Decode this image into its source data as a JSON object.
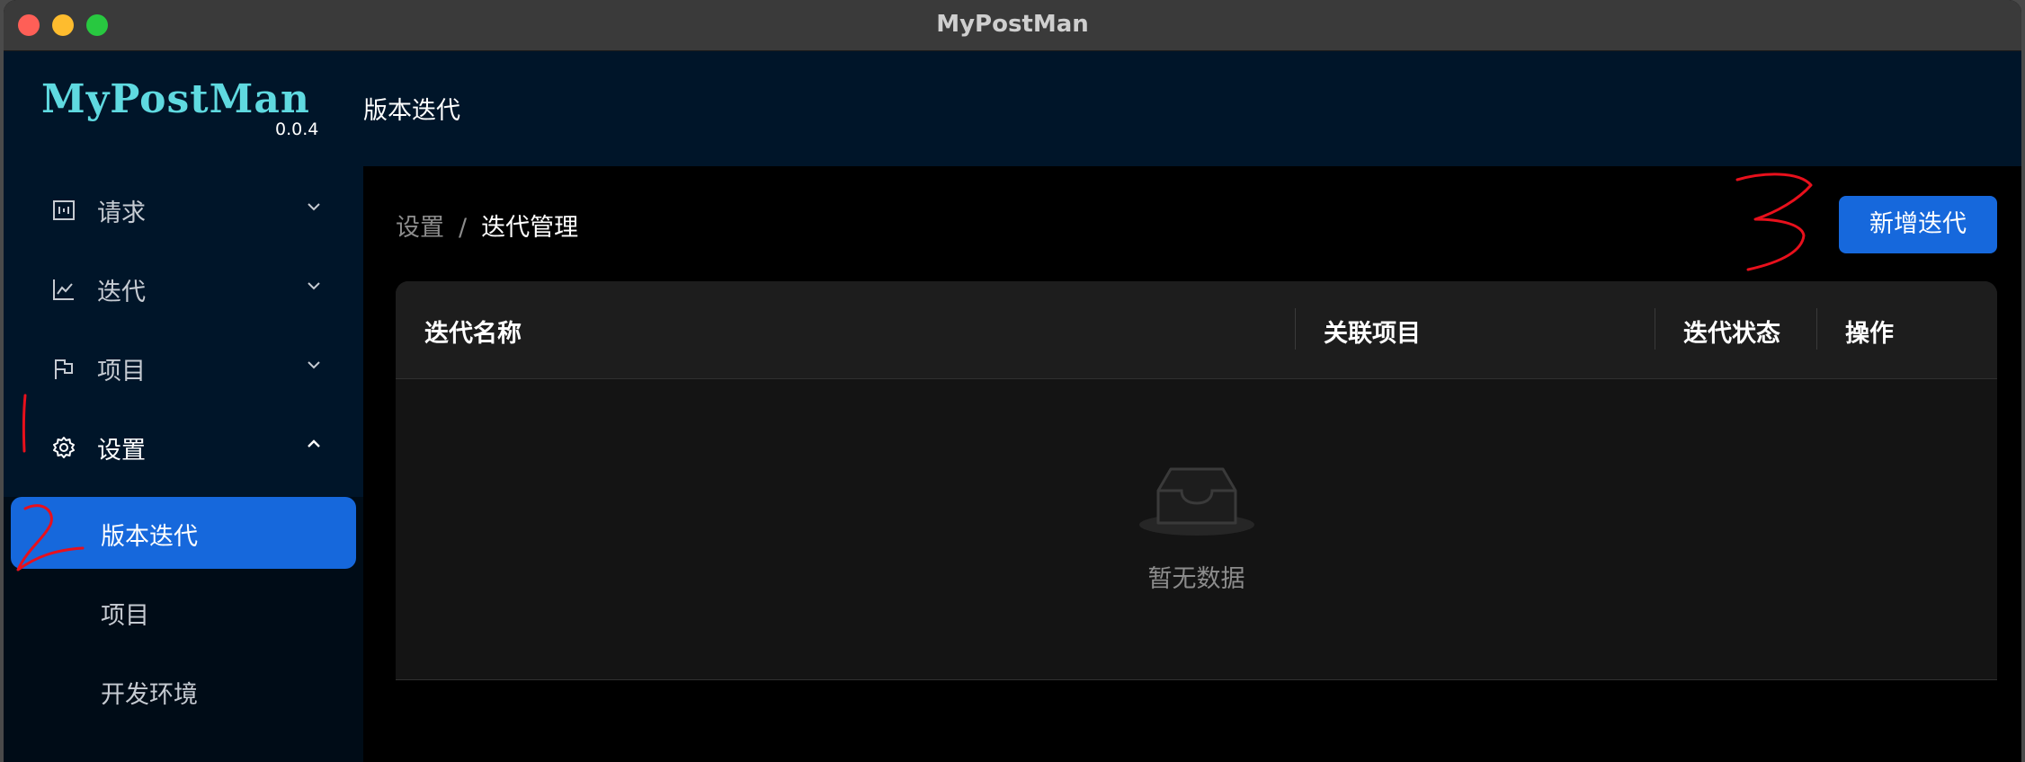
{
  "window": {
    "title": "MyPostMan"
  },
  "sidebar": {
    "logo": "MyPostMan",
    "version": "0.0.4",
    "menu": [
      {
        "label": "请求",
        "icon": "request-icon",
        "expanded": false
      },
      {
        "label": "迭代",
        "icon": "chart-line-icon",
        "expanded": false
      },
      {
        "label": "项目",
        "icon": "flag-icon",
        "expanded": false
      },
      {
        "label": "设置",
        "icon": "gear-icon",
        "expanded": true
      }
    ],
    "submenu": [
      {
        "label": "版本迭代",
        "active": true
      },
      {
        "label": "项目",
        "active": false
      },
      {
        "label": "开发环境",
        "active": false
      }
    ]
  },
  "header": {
    "title": "版本迭代"
  },
  "breadcrumb": {
    "parent": "设置",
    "separator": "/",
    "current": "迭代管理"
  },
  "toolbar": {
    "add_label": "新增迭代"
  },
  "table": {
    "columns": [
      "迭代名称",
      "关联项目",
      "迭代状态",
      "操作"
    ],
    "rows": [],
    "empty_text": "暂无数据"
  },
  "annotations": [
    "1",
    "2",
    "3"
  ],
  "colors": {
    "accent": "#1668dc",
    "sidebar_bg": "#001529",
    "logo": "#5fd9e0",
    "annotation": "#e8101c"
  }
}
